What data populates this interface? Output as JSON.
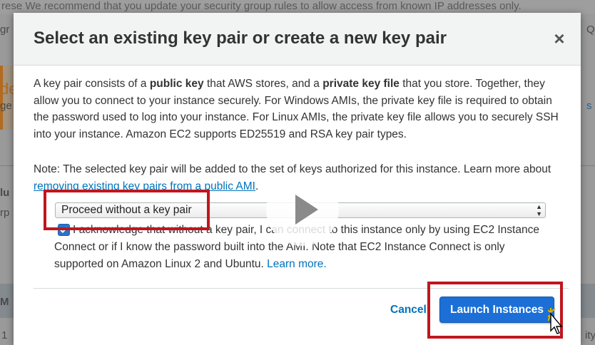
{
  "background": {
    "top_text": "rese   We recommend that you update your security group rules to allow access from known IP addresses only.",
    "left_fragments": [
      "gr",
      "de",
      "ge",
      "lu",
      "rp",
      "M",
      "1"
    ],
    "right_fragments": [
      "Q",
      "s",
      "ity"
    ]
  },
  "modal": {
    "title": "Select an existing key pair or create a new key pair",
    "close_label": "×",
    "paragraph1_a": "A key pair consists of a ",
    "paragraph1_b": "public key",
    "paragraph1_c": " that AWS stores, and a ",
    "paragraph1_d": "private key file",
    "paragraph1_e": " that you store. Together, they allow you to connect to your instance securely. For Windows AMIs, the private key file is required to obtain the password used to log into your instance. For Linux AMIs, the private key file allows you to securely SSH into your instance. Amazon EC2 supports ED25519 and RSA key pair types.",
    "note_text": "Note: The selected key pair will be added to the set of keys authorized for this instance. Learn more about ",
    "note_link": "removing existing key pairs from a public AMI",
    "note_end": ".",
    "select_value": "Proceed without a key pair",
    "ack_checked": true,
    "ack_text": "I acknowledge that without a key pair, I can connect to this instance only by using EC2 Instance Connect or if I know the password built into the AMI. Note that EC2 Instance Connect is only supported on Amazon Linux 2 and Ubuntu. ",
    "ack_link": "Learn more.",
    "cancel_label": "Cancel",
    "launch_label": "Launch Instances"
  },
  "colors": {
    "primary_button": "#1b6fd6",
    "link": "#0073bb",
    "highlight": "#c0161e"
  },
  "icons": {
    "play": "play-icon",
    "close": "close-icon",
    "cursor": "mouse-cursor-icon",
    "check": "checkmark-icon"
  }
}
